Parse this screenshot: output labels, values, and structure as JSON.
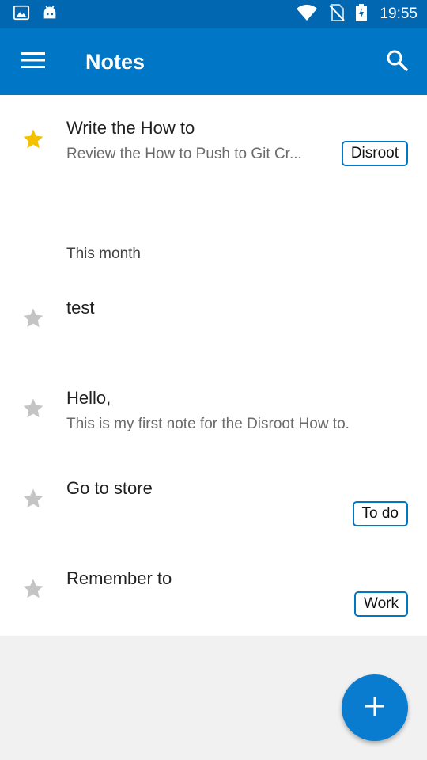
{
  "status": {
    "time": "19:55"
  },
  "app_bar": {
    "title": "Notes"
  },
  "notes": [
    {
      "title": "Write the How to",
      "preview": "Review the How to Push to Git Cr...",
      "tag": "Disroot",
      "starred": true
    },
    {
      "title": "test",
      "preview": "",
      "tag": "",
      "starred": false
    },
    {
      "title": "Hello,",
      "preview": "This is my first note for the Disroot How to.",
      "tag": "",
      "starred": false
    },
    {
      "title": "Go to store",
      "preview": "",
      "tag": "To do",
      "starred": false
    },
    {
      "title": "Remember to",
      "preview": "",
      "tag": "Work",
      "starred": false
    }
  ],
  "section": {
    "this_month": "This month"
  },
  "colors": {
    "accent": "#0077c6",
    "status_bar": "#0067b0",
    "star_active": "#f5c000",
    "star_inactive": "#c4c4c4"
  },
  "icons": {
    "menu": "hamburger-icon",
    "search": "search-icon",
    "add": "plus-icon",
    "star": "star-icon"
  }
}
